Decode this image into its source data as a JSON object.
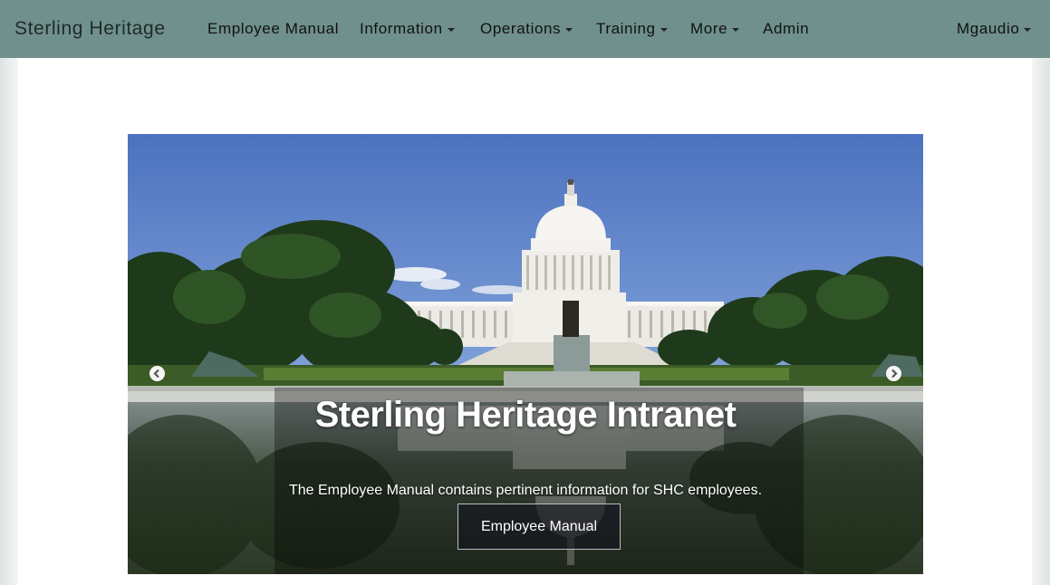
{
  "navbar": {
    "brand": "Sterling Heritage",
    "items": [
      {
        "label": "Employee Manual",
        "dropdown": false
      },
      {
        "label": "Information",
        "dropdown": true
      },
      {
        "label": "Operations",
        "dropdown": true
      },
      {
        "label": "Training",
        "dropdown": true
      },
      {
        "label": "More",
        "dropdown": true
      },
      {
        "label": "Admin",
        "dropdown": false
      }
    ],
    "user": {
      "label": "Mgaudio",
      "dropdown": true
    },
    "bg_color": "#6f908c"
  },
  "carousel": {
    "title": "Sterling Heritage Intranet",
    "text": "The Employee Manual contains pertinent information for SHC employees.",
    "button_label": "Employee Manual",
    "prev_icon": "chevron-left-circle-icon",
    "next_icon": "chevron-right-circle-icon"
  }
}
